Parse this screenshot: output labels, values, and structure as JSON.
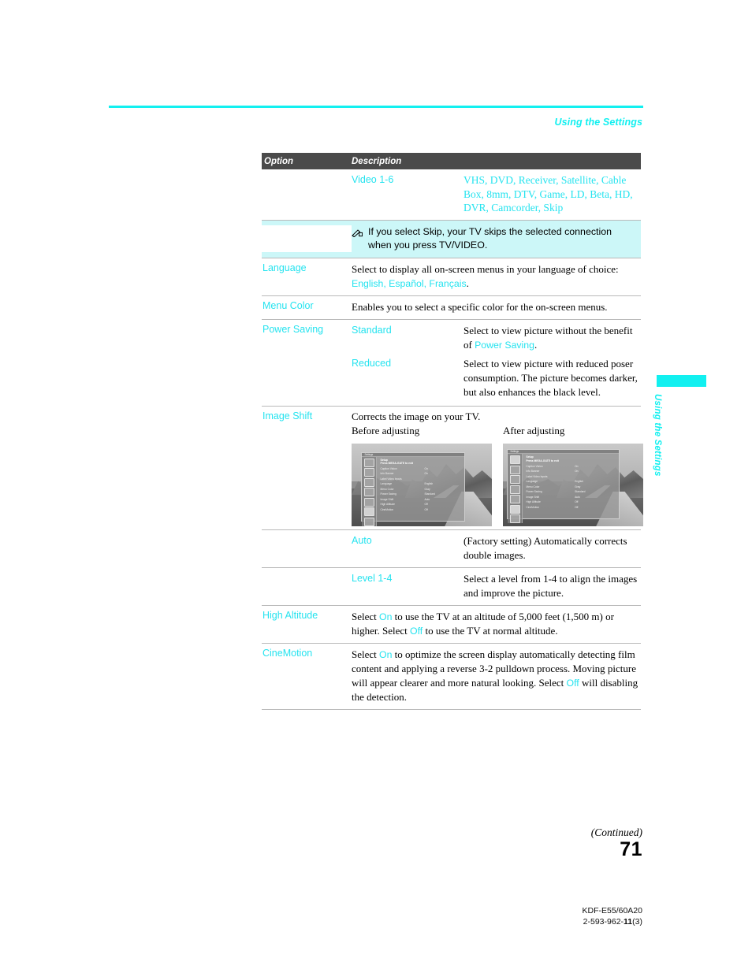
{
  "page": {
    "running_head": "Using the Settings",
    "side_tab_text": "Using the Settings",
    "continued": "(Continued)",
    "page_number": "71",
    "model": "KDF-E55/60A20",
    "doc_number_prefix": "2-593-962-",
    "doc_number_bold": "11",
    "doc_number_suffix": "(3)",
    "accent_cyan": "#12f0f0",
    "link_cyan": "#25e3ef",
    "header_gray": "#4a4a4a",
    "note_bg": "#ccf7f8"
  },
  "table": {
    "headers": {
      "option": "Option",
      "description": "Description"
    },
    "rows": {
      "video": {
        "option": "",
        "sub": "Video 1-6",
        "values": "VHS, DVD, Receiver, Satellite, Cable Box, 8mm, DTV, Game, LD, Beta, HD, DVR, Camcorder, Skip"
      },
      "note": {
        "icon": "pencil-note-icon",
        "text": "If you select Skip, your TV skips the selected connection when you press TV/VIDEO."
      },
      "language": {
        "option": "Language",
        "desc_part1": "Select to display all on-screen menus in your language of choice: ",
        "desc_highlight": "English, Español, Français",
        "desc_part2": "."
      },
      "menu_color": {
        "option": "Menu Color",
        "desc": "Enables you to select a specific color for the on-screen menus."
      },
      "power_saving": {
        "option": "Power Saving",
        "items": [
          {
            "label": "Standard",
            "desc_part1": "Select to view picture without the benefit of ",
            "desc_highlight": "Power Saving",
            "desc_part2": "."
          },
          {
            "label": "Reduced",
            "desc_part1": "Select to view picture with reduced poser consumption. The picture becomes darker, but also enhances the black level.",
            "desc_highlight": "",
            "desc_part2": ""
          }
        ]
      },
      "image_shift": {
        "option": "Image Shift",
        "desc": "Corrects the image on your TV.",
        "figure_label_before": "Before adjusting",
        "figure_label_after": "After adjusting",
        "items": [
          {
            "label": "Auto",
            "desc": "(Factory setting) Automatically corrects double images."
          },
          {
            "label": "Level 1-4",
            "desc": "Select a level from 1-4 to align the images and improve the picture."
          }
        ]
      },
      "high_altitude": {
        "option": "High Altitude",
        "seg1": "Select ",
        "hl1": "On",
        "seg2": " to use the TV at an altitude of 5,000 feet (1,500 m) or higher. Select ",
        "hl2": "Off",
        "seg3": " to use the TV at normal altitude."
      },
      "cinemotion": {
        "option": "CineMotion",
        "seg1": "Select ",
        "hl1": "On",
        "seg2": " to optimize the screen display automatically detecting film content and applying a reverse 3-2 pulldown process. Moving picture will appear clearer and more natural looking. Select ",
        "hl2": "Off",
        "seg3": " will disabling the detection."
      }
    }
  },
  "tv_osd": {
    "before": {
      "title": "Settings",
      "heading_line1": "Setup",
      "heading_line2": "Press MEGA-GATE to exit",
      "rows": [
        {
          "key": "Caption Vision",
          "value": "On"
        },
        {
          "key": "Info Banner",
          "value": "On"
        },
        {
          "key": "Label Video Inputs",
          "value": ""
        },
        {
          "key": "Language",
          "value": "English"
        },
        {
          "key": "Menu Color",
          "value": "Gray"
        },
        {
          "key": "Power Saving",
          "value": "Standard"
        },
        {
          "key": "Image Shift",
          "value": "Auto"
        },
        {
          "key": "High Altitude",
          "value": "Off"
        },
        {
          "key": "CineMotion",
          "value": "Off"
        }
      ]
    },
    "after": {
      "title": "Settings",
      "heading_line1": "Setup",
      "heading_line2": "Press MEGA-GATE to exit",
      "rows": [
        {
          "key": "Caption Vision",
          "value": "On"
        },
        {
          "key": "Info Banner",
          "value": "On"
        },
        {
          "key": "Label Video Inputs",
          "value": ""
        },
        {
          "key": "Language",
          "value": "English"
        },
        {
          "key": "Menu Color",
          "value": "Gray"
        },
        {
          "key": "Power Saving",
          "value": "Standard"
        },
        {
          "key": "Image Shift",
          "value": "Auto"
        },
        {
          "key": "High Altitude",
          "value": "Off"
        },
        {
          "key": "CineMotion",
          "value": "Off"
        }
      ]
    }
  }
}
